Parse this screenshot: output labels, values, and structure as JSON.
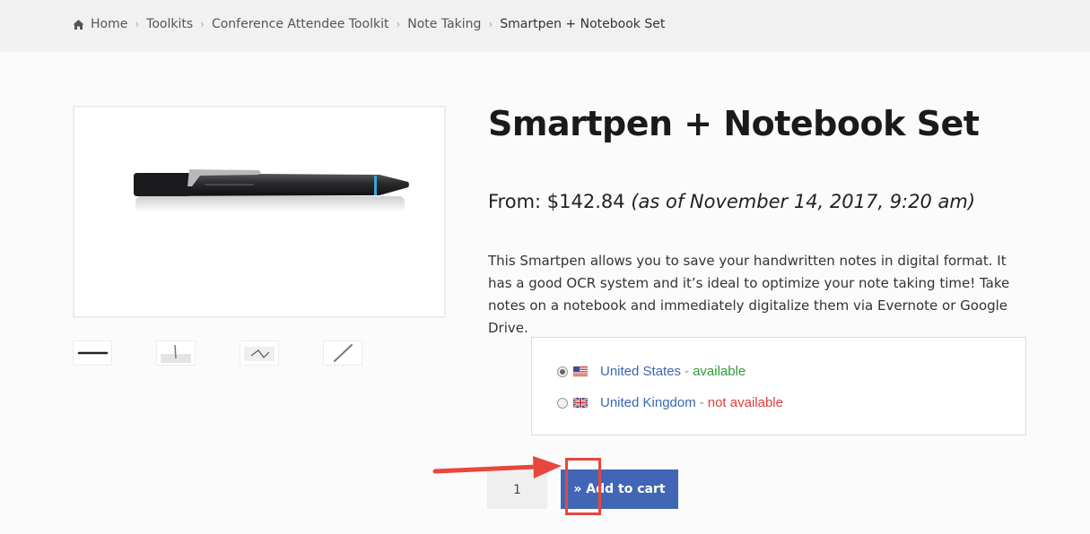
{
  "breadcrumb": {
    "icon": "home-icon",
    "items": [
      "Home",
      "Toolkits",
      "Conference Attendee Toolkit",
      "Note Taking"
    ],
    "current": "Smartpen + Notebook Set"
  },
  "product": {
    "title": "Smartpen + Notebook Set",
    "price_prefix": "From: $142.84",
    "price_note": "(as of November 14, 2017, 9:20 am)",
    "description": "This Smartpen allows you to save your handwritten notes in digital format. It has a good OCR system and it’s ideal to optimize your note taking time! Take notes on a notebook and immediately digitalize them via Evernote or Google Drive."
  },
  "availability": [
    {
      "country": "United States",
      "separator": "-",
      "status": "available",
      "selected": true,
      "flag": "us-flag-icon",
      "status_color": "#2e9e35"
    },
    {
      "country": "United Kingdom",
      "separator": "-",
      "status": "not available",
      "selected": false,
      "flag": "uk-flag-icon",
      "status_color": "#e03b3b"
    }
  ],
  "cart": {
    "quantity": "1",
    "button_label": "» Add to cart"
  },
  "colors": {
    "accent": "#4166b5",
    "annotation": "#e8473c"
  }
}
